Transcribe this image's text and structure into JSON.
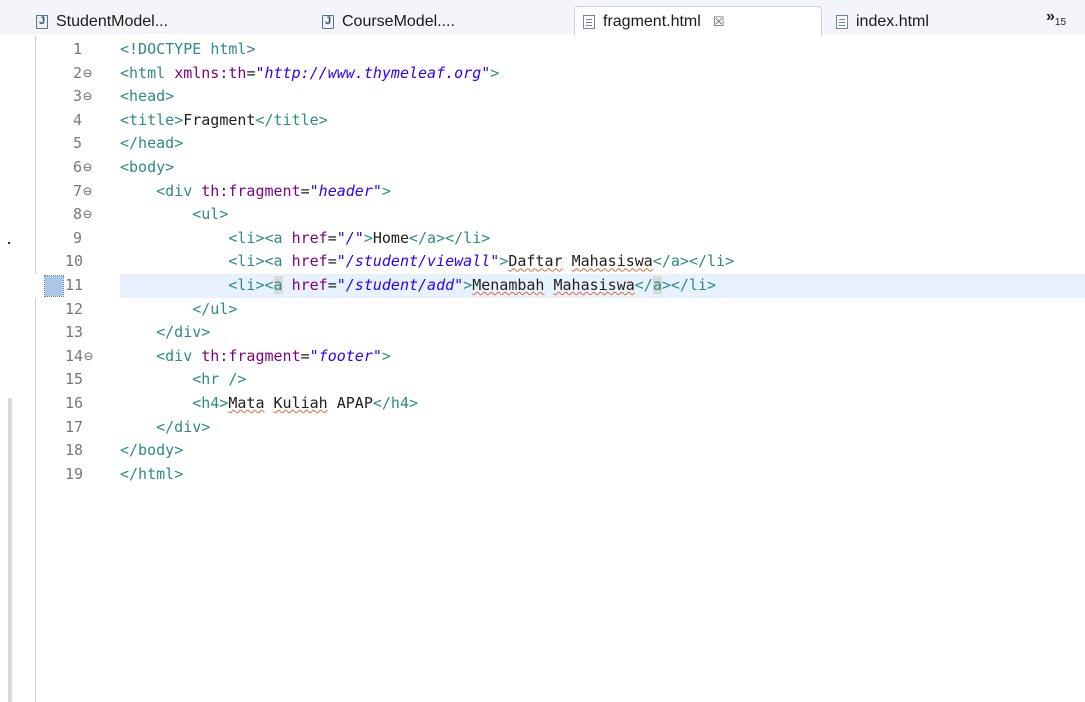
{
  "tabs": [
    {
      "label": "StudentModel...",
      "icon": "java-file-icon",
      "active": false
    },
    {
      "label": "CourseModel....",
      "icon": "java-file-icon",
      "active": false
    },
    {
      "label": "fragment.html",
      "icon": "html-file-icon",
      "active": true
    },
    {
      "label": "index.html",
      "icon": "html-file-icon",
      "active": false
    }
  ],
  "tab_overflow": {
    "symbol": "»",
    "count": "15"
  },
  "close_symbol": "☒",
  "current_line": 11,
  "lines": [
    {
      "n": "1",
      "fold": "",
      "code": "<!DOCTYPE html>"
    },
    {
      "n": "2",
      "fold": "⊖",
      "code": "<html xmlns:th=\"http://www.thymeleaf.org\">"
    },
    {
      "n": "3",
      "fold": "⊖",
      "code": "<head>"
    },
    {
      "n": "4",
      "fold": "",
      "code": "<title>Fragment</title>"
    },
    {
      "n": "5",
      "fold": "",
      "code": "</head>"
    },
    {
      "n": "6",
      "fold": "⊖",
      "code": "<body>"
    },
    {
      "n": "7",
      "fold": "⊖",
      "code": "    <div th:fragment=\"header\">"
    },
    {
      "n": "8",
      "fold": "⊖",
      "code": "        <ul>"
    },
    {
      "n": "9",
      "fold": "",
      "code": "            <li><a href=\"/\">Home</a></li>"
    },
    {
      "n": "10",
      "fold": "",
      "code": "            <li><a href=\"/student/viewall\">Daftar Mahasiswa</a></li>"
    },
    {
      "n": "11",
      "fold": "",
      "code": "            <li><a href=\"/student/add\">Menambah Mahasiswa</a></li>"
    },
    {
      "n": "12",
      "fold": "",
      "code": "        </ul>"
    },
    {
      "n": "13",
      "fold": "",
      "code": "    </div>"
    },
    {
      "n": "14",
      "fold": "⊖",
      "code": "    <div th:fragment=\"footer\">"
    },
    {
      "n": "15",
      "fold": "",
      "code": "        <hr />"
    },
    {
      "n": "16",
      "fold": "",
      "code": "        <h4>Mata Kuliah APAP</h4>"
    },
    {
      "n": "17",
      "fold": "",
      "code": "    </div>"
    },
    {
      "n": "18",
      "fold": "",
      "code": "</body>"
    },
    {
      "n": "19",
      "fold": "",
      "code": "</html>"
    }
  ],
  "spellcheck_words": [
    "Daftar",
    "Mahasiswa",
    "Menambah",
    "Mata",
    "Kuliah"
  ],
  "colors": {
    "tag": "#2e8b7f",
    "attribute": "#7f007f",
    "value": "#2a00ff",
    "current_line": "#e8f2fe"
  }
}
